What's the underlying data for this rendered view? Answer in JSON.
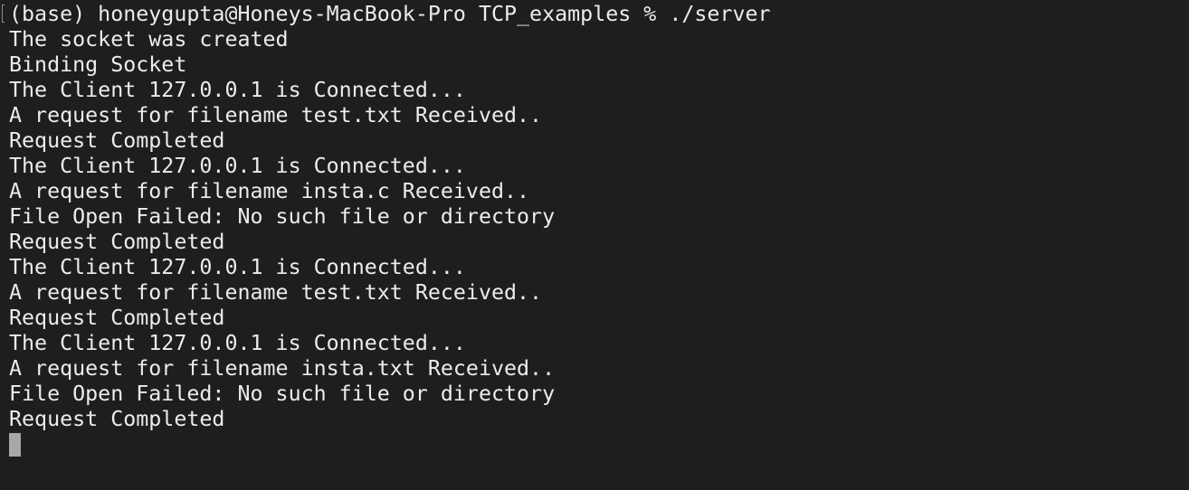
{
  "terminal": {
    "prompt": "(base) honeygupta@Honeys-MacBook-Pro TCP_examples % ./server",
    "lines": [
      "The socket was created",
      "Binding Socket",
      "The Client 127.0.0.1 is Connected...",
      "A request for filename test.txt Received..",
      "Request Completed",
      "The Client 127.0.0.1 is Connected...",
      "A request for filename insta.c Received..",
      "File Open Failed: No such file or directory",
      "Request Completed",
      "The Client 127.0.0.1 is Connected...",
      "A request for filename test.txt Received..",
      "Request Completed",
      "The Client 127.0.0.1 is Connected...",
      "A request for filename insta.txt Received..",
      "File Open Failed: No such file or directory",
      "Request Completed"
    ]
  }
}
